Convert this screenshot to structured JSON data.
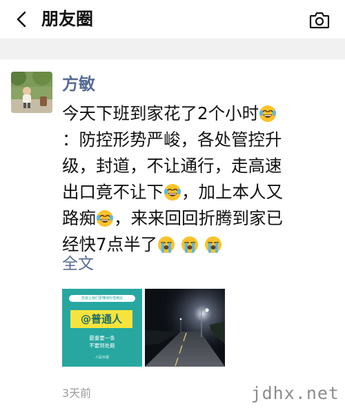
{
  "nav": {
    "title": "朋友圈",
    "back_icon": "chevron-left-icon",
    "camera_icon": "camera-icon"
  },
  "post": {
    "author": "方敏",
    "avatar": "avatar-photo",
    "lines": [
      "今天下班到家花了2个小时",
      "：防控形势严峻，各处管控升",
      "级，封道，不让通行，走高速",
      "出口竟不让下",
      "，加上本人又",
      "路痴",
      "，来来回回折腾到家已",
      "经快7点半了"
    ],
    "full_text_link": "全文",
    "timestamp": "3天前"
  },
  "images": {
    "card": {
      "top_banner": "抗疫让我们更懂得珍惜彼此",
      "tag": "@普通人",
      "sub_line1": "最重要一条",
      "sub_line2": "不要到处跑",
      "brand": "人民日报"
    }
  },
  "watermark": "jdhx.net",
  "colors": {
    "link": "#576b95",
    "separator": "#f1f1f1",
    "timestamp": "#9b9b9b",
    "card_teal": "#27a7a0",
    "card_tag_yellow": "#f7e33d"
  },
  "emoji": {
    "tears_of_joy": "face-with-tears-of-joy-icon",
    "crying": "loudly-crying-face-icon"
  }
}
